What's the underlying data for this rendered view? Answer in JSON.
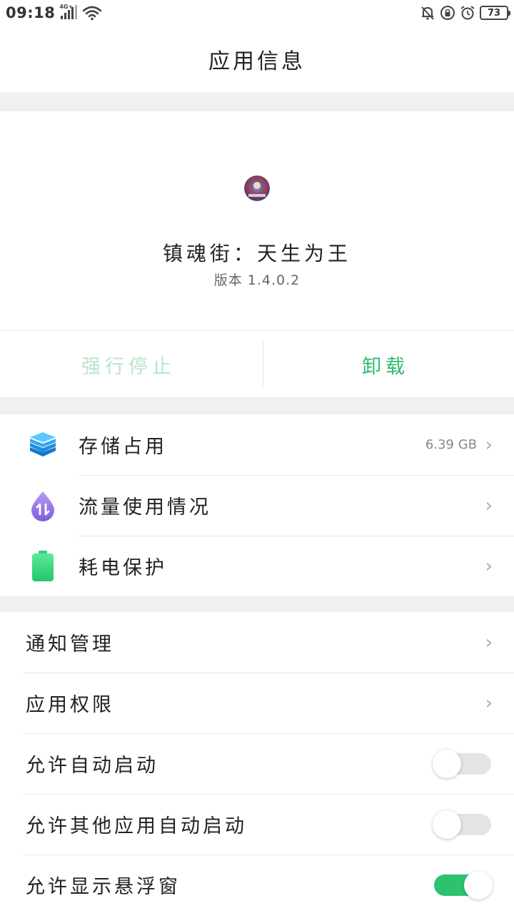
{
  "status_bar": {
    "time": "09:18",
    "network": "4G+",
    "battery": "73",
    "icons": [
      "4g-signal-icon",
      "wifi-icon",
      "muted-bell-icon",
      "lock-rotation-icon",
      "alarm-icon",
      "battery-icon"
    ]
  },
  "header": {
    "title": "应用信息"
  },
  "app": {
    "name": "镇魂街：天生为王",
    "version": "版本 1.4.0.2",
    "icon": "app-icon"
  },
  "actions": {
    "force_stop": "强行停止",
    "uninstall": "卸载",
    "colors": {
      "disabled": "#b7e6cb",
      "enabled": "#2dbb6a"
    }
  },
  "usage_items": [
    {
      "label": "存储占用",
      "value": "6.39 GB",
      "icon": "storage-layers-icon"
    },
    {
      "label": "流量使用情况",
      "value": "",
      "icon": "data-usage-drop-icon"
    },
    {
      "label": "耗电保护",
      "value": "",
      "icon": "battery-protect-icon"
    }
  ],
  "settings_items": [
    {
      "label": "通知管理",
      "type": "link"
    },
    {
      "label": "应用权限",
      "type": "link"
    },
    {
      "label": "允许自动启动",
      "type": "toggle",
      "on": false
    },
    {
      "label": "允许其他应用自动启动",
      "type": "toggle",
      "on": false
    },
    {
      "label": "允许显示悬浮窗",
      "type": "toggle",
      "on": true
    }
  ],
  "chevron": "›",
  "accent": "#2ec270"
}
